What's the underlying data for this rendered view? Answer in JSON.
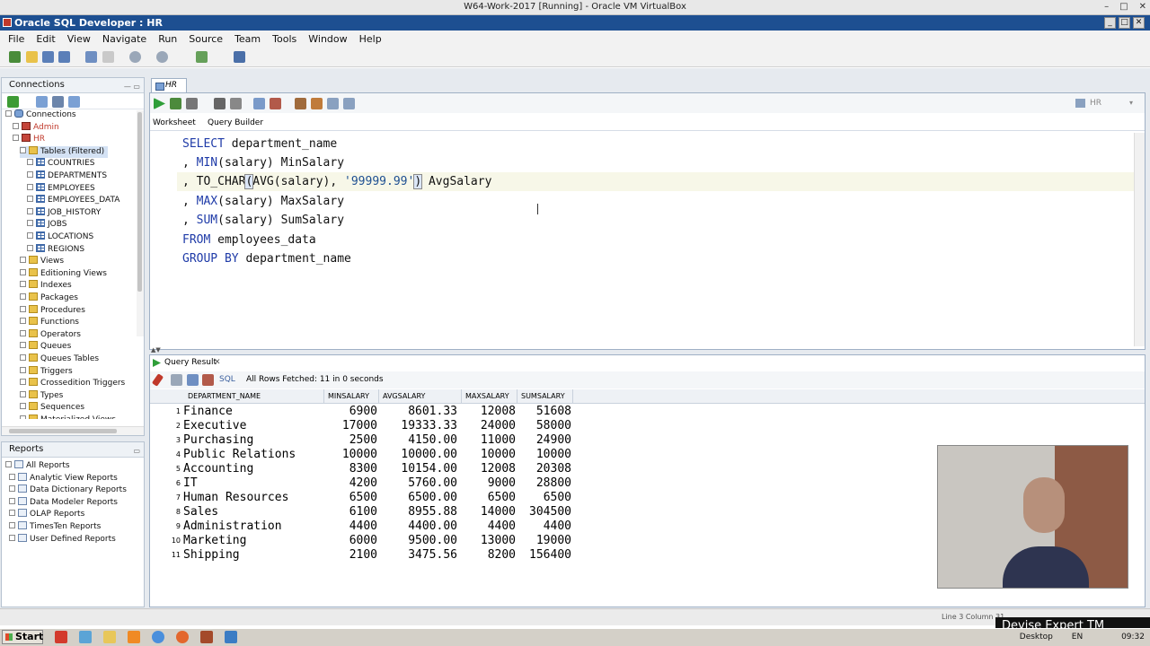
{
  "vbox_title": "W64-Work-2017 [Running] - Oracle VM VirtualBox",
  "app_title": "Oracle SQL Developer : HR",
  "menu": [
    "File",
    "Edit",
    "View",
    "Navigate",
    "Run",
    "Source",
    "Team",
    "Tools",
    "Window",
    "Help"
  ],
  "connections_panel": {
    "title": "Connections",
    "items": [
      {
        "label": "Connections",
        "indent": 0,
        "icon": "db"
      },
      {
        "label": "Admin",
        "indent": 1,
        "icon": "conn",
        "color": "#c0392b"
      },
      {
        "label": "HR",
        "indent": 1,
        "icon": "conn",
        "color": "#c0392b"
      },
      {
        "label": "Tables (Filtered)",
        "indent": 2,
        "icon": "folder",
        "selected": true
      },
      {
        "label": "COUNTRIES",
        "indent": 3,
        "icon": "table"
      },
      {
        "label": "DEPARTMENTS",
        "indent": 3,
        "icon": "table"
      },
      {
        "label": "EMPLOYEES",
        "indent": 3,
        "icon": "table"
      },
      {
        "label": "EMPLOYEES_DATA",
        "indent": 3,
        "icon": "table"
      },
      {
        "label": "JOB_HISTORY",
        "indent": 3,
        "icon": "table"
      },
      {
        "label": "JOBS",
        "indent": 3,
        "icon": "table"
      },
      {
        "label": "LOCATIONS",
        "indent": 3,
        "icon": "table"
      },
      {
        "label": "REGIONS",
        "indent": 3,
        "icon": "table"
      },
      {
        "label": "Views",
        "indent": 2,
        "icon": "folder"
      },
      {
        "label": "Editioning Views",
        "indent": 2,
        "icon": "folder"
      },
      {
        "label": "Indexes",
        "indent": 2,
        "icon": "folder"
      },
      {
        "label": "Packages",
        "indent": 2,
        "icon": "folder"
      },
      {
        "label": "Procedures",
        "indent": 2,
        "icon": "folder"
      },
      {
        "label": "Functions",
        "indent": 2,
        "icon": "folder"
      },
      {
        "label": "Operators",
        "indent": 2,
        "icon": "folder"
      },
      {
        "label": "Queues",
        "indent": 2,
        "icon": "folder"
      },
      {
        "label": "Queues Tables",
        "indent": 2,
        "icon": "folder"
      },
      {
        "label": "Triggers",
        "indent": 2,
        "icon": "folder"
      },
      {
        "label": "Crossedition Triggers",
        "indent": 2,
        "icon": "folder"
      },
      {
        "label": "Types",
        "indent": 2,
        "icon": "folder"
      },
      {
        "label": "Sequences",
        "indent": 2,
        "icon": "folder"
      },
      {
        "label": "Materialized Views",
        "indent": 2,
        "icon": "folder"
      }
    ]
  },
  "reports_panel": {
    "title": "Reports",
    "items": [
      {
        "label": "All Reports",
        "indent": 0
      },
      {
        "label": "Analytic View Reports",
        "indent": 1
      },
      {
        "label": "Data Dictionary Reports",
        "indent": 1
      },
      {
        "label": "Data Modeler Reports",
        "indent": 1
      },
      {
        "label": "OLAP Reports",
        "indent": 1
      },
      {
        "label": "TimesTen Reports",
        "indent": 1
      },
      {
        "label": "User Defined Reports",
        "indent": 1
      }
    ]
  },
  "editor": {
    "tab": "HR",
    "subtabs": {
      "worksheet": "Worksheet",
      "query_builder": "Query Builder"
    },
    "connection_selector": "HR"
  },
  "results": {
    "tab": "Query Result",
    "sql_label": "SQL",
    "status": "All Rows Fetched: 11 in 0 seconds",
    "columns": [
      "DEPARTMENT_NAME",
      "MINSALARY",
      "AVGSALARY",
      "MAXSALARY",
      "SUMSALARY"
    ],
    "rows": [
      [
        "1",
        "Finance",
        "6900",
        "8601.33",
        "12008",
        "51608"
      ],
      [
        "2",
        "Executive",
        "17000",
        "19333.33",
        "24000",
        "58000"
      ],
      [
        "3",
        "Purchasing",
        "2500",
        "4150.00",
        "11000",
        "24900"
      ],
      [
        "4",
        "Public Relations",
        "10000",
        "10000.00",
        "10000",
        "10000"
      ],
      [
        "5",
        "Accounting",
        "8300",
        "10154.00",
        "12008",
        "20308"
      ],
      [
        "6",
        "IT",
        "4200",
        "5760.00",
        "9000",
        "28800"
      ],
      [
        "7",
        "Human Resources",
        "6500",
        "6500.00",
        "6500",
        "6500"
      ],
      [
        "8",
        "Sales",
        "6100",
        "8955.88",
        "14000",
        "304500"
      ],
      [
        "9",
        "Administration",
        "4400",
        "4400.00",
        "4400",
        "4400"
      ],
      [
        "10",
        "Marketing",
        "6000",
        "9500.00",
        "13000",
        "19000"
      ],
      [
        "11",
        "Shipping",
        "2100",
        "3475.56",
        "8200",
        "156400"
      ]
    ]
  },
  "status": {
    "position": "Line 3 Column 31"
  },
  "brand": "Devise Expert TM",
  "taskbar": {
    "start": "Start",
    "desktop": "Desktop",
    "lang": "EN",
    "time": "09:32"
  }
}
